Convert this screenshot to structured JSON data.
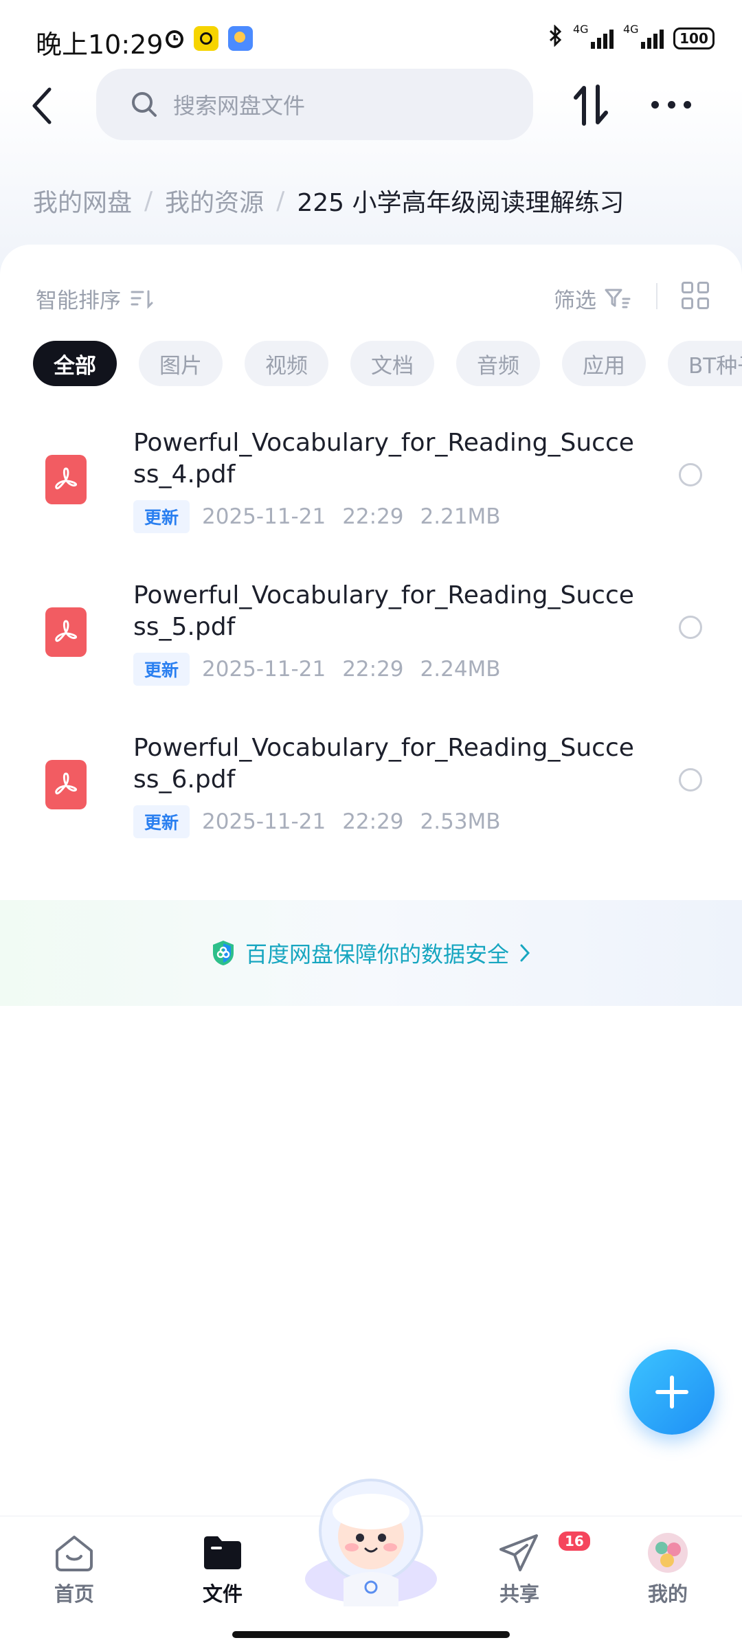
{
  "status_bar": {
    "time": "晚上10:29",
    "network_left": "4G",
    "network_right": "4G",
    "battery": "100"
  },
  "header": {
    "search_placeholder": "搜索网盘文件"
  },
  "breadcrumb": {
    "items": [
      "我的网盘",
      "我的资源"
    ],
    "current": "225  小学高年级阅读理解练习"
  },
  "toolbar": {
    "sort_label": "智能排序",
    "filter_label": "筛选"
  },
  "categories": [
    "全部",
    "图片",
    "视频",
    "文档",
    "音频",
    "应用",
    "BT种子"
  ],
  "selected_category": "全部",
  "files": [
    {
      "name": "Powerful_Vocabulary_for_Reading_Success_4.pdf",
      "badge": "更新",
      "date": "2025-11-21",
      "time": "22:29",
      "size": "2.21MB"
    },
    {
      "name": "Powerful_Vocabulary_for_Reading_Success_5.pdf",
      "badge": "更新",
      "date": "2025-11-21",
      "time": "22:29",
      "size": "2.24MB"
    },
    {
      "name": "Powerful_Vocabulary_for_Reading_Success_6.pdf",
      "badge": "更新",
      "date": "2025-11-21",
      "time": "22:29",
      "size": "2.53MB"
    }
  ],
  "security_banner": "百度网盘保障你的数据安全",
  "bottom_nav": {
    "home": "首页",
    "files": "文件",
    "share": "共享",
    "share_badge": "16",
    "mine": "我的",
    "active": "files"
  },
  "colors": {
    "accent": "#1e8ff5",
    "file_pdf": "#f25c62",
    "security_text": "#17a6c0",
    "badge_red": "#f5455c"
  }
}
